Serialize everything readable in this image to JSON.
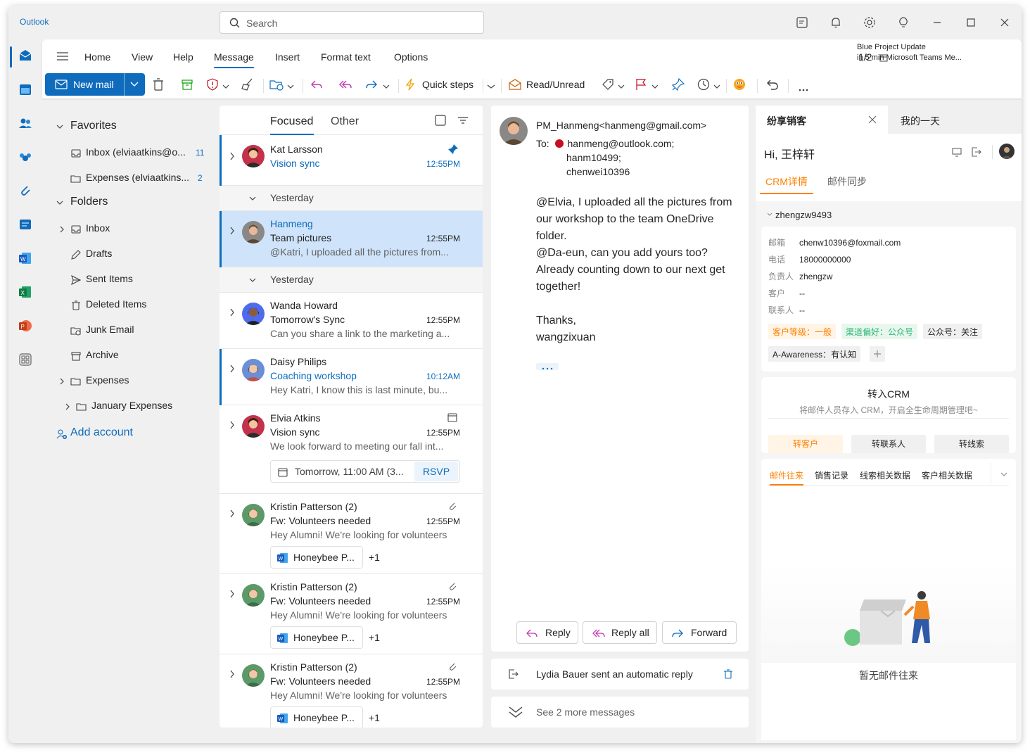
{
  "app": {
    "name": "Outlook"
  },
  "search": {
    "placeholder": "Search"
  },
  "ribbon": {
    "tabs": [
      "Home",
      "View",
      "Help",
      "Message",
      "Insert",
      "Format text",
      "Options"
    ],
    "active_tab": "Message",
    "pager": "1/2",
    "reminder_title": "Blue Project Update",
    "reminder_sub": "in 5 min Microsoft Teams Me...",
    "new_mail": "New mail",
    "quick_steps": "Quick steps",
    "read_unread": "Read/Unread"
  },
  "nav": {
    "favorites": "Favorites",
    "fav_items": [
      {
        "label": "Inbox (elviaatkins@o...",
        "count": "11"
      },
      {
        "label": "Expenses (elviaatkins...",
        "count": "2"
      }
    ],
    "folders": "Folders",
    "folder_items": [
      "Inbox",
      "Drafts",
      "Sent Items",
      "Deleted Items",
      "Junk Email",
      "Archive",
      "Expenses",
      "January Expenses"
    ],
    "add_account": "Add account"
  },
  "list": {
    "tab_focused": "Focused",
    "tab_other": "Other",
    "group_yesterday": "Yesterday",
    "messages": [
      {
        "sender": "Kat Larsson",
        "subject": "Vision sync",
        "time": "12:55PM",
        "preview": ""
      },
      {
        "sender": "Hanmeng",
        "subject": "Team pictures",
        "time": "12:55PM",
        "preview": "@Katri, I uploaded all the pictures from..."
      },
      {
        "sender": "Wanda Howard",
        "subject": "Tomorrow's Sync",
        "time": "12:55PM",
        "preview": "Can you share a link to the marketing a..."
      },
      {
        "sender": "Daisy Philips",
        "subject": "Coaching workshop",
        "time": "10:12AM",
        "preview": "Hey Katri, I know this is last minute, bu..."
      },
      {
        "sender": "Elvia Atkins",
        "subject": "Vision sync",
        "time": "12:55PM",
        "preview": "We look forward to meeting our fall int..."
      },
      {
        "sender": "Kristin Patterson (2)",
        "subject": "Fw: Volunteers needed",
        "time": "12:55PM",
        "preview": "Hey Alumni! We're looking for volunteers"
      },
      {
        "sender": "Kristin Patterson (2)",
        "subject": "Fw: Volunteers needed",
        "time": "12:55PM",
        "preview": "Hey Alumni! We're looking for volunteers"
      },
      {
        "sender": "Kristin Patterson (2)",
        "subject": "Fw: Volunteers needed",
        "time": "12:55PM",
        "preview": "Hey Alumni! We're looking for volunteers"
      }
    ],
    "event_text": "Tomorrow, 11:00 AM (3...",
    "rsvp": "RSVP",
    "attachment": "Honeybee P...",
    "attachment_more": "+1"
  },
  "reading": {
    "from": "PM_Hanmeng<hanmeng@gmail.com>",
    "to_label": "To:",
    "to_1": "hanmeng@outlook.com;",
    "to_2": "hanm10499;",
    "to_3": "chenwei10396",
    "body_1": "@Elvia, I uploaded all the pictures from our workshop to the team OneDrive folder.",
    "body_2": "@Da-eun, can you add yours too? Already counting down to our next get together!",
    "thanks": "Thanks,",
    "signature": "wangzixuan",
    "reply": "Reply",
    "reply_all": "Reply all",
    "forward": "Forward",
    "auto_reply": "Lydia Bauer sent an automatic reply",
    "see_more": "See 2 more messages"
  },
  "crm": {
    "tab_1": "纷享销客",
    "tab_2": "我的一天",
    "greeting": "Hi, 王梓轩",
    "subtab_1": "CRM详情",
    "subtab_2": "邮件同步",
    "contact": "zhengzw9493",
    "fields": [
      {
        "k": "邮箱",
        "v": "chenw10396@foxmail.com"
      },
      {
        "k": "电话",
        "v": "18000000000"
      },
      {
        "k": "负责人",
        "v": "zhengzw"
      },
      {
        "k": "客户",
        "v": "--"
      },
      {
        "k": "联系人",
        "v": "--"
      }
    ],
    "tag_1": "客户等级：一般",
    "tag_2": "渠道偏好：公众号",
    "tag_3": "公众号：关注",
    "tag_4": "A-Awareness：有认知",
    "convert_title": "转入CRM",
    "convert_desc": "将邮件人员存入 CRM，开启全生命周期管理吧~",
    "btn_customer": "转客户",
    "btn_contact": "转联系人",
    "btn_lead": "转线索",
    "data_tabs": [
      "邮件往来",
      "销售记录",
      "线索相关数据",
      "客户相关数据"
    ],
    "empty": "暂无邮件往来"
  },
  "colors": {
    "accent": "#0f6cbd",
    "crm_orange": "#ff8000"
  }
}
